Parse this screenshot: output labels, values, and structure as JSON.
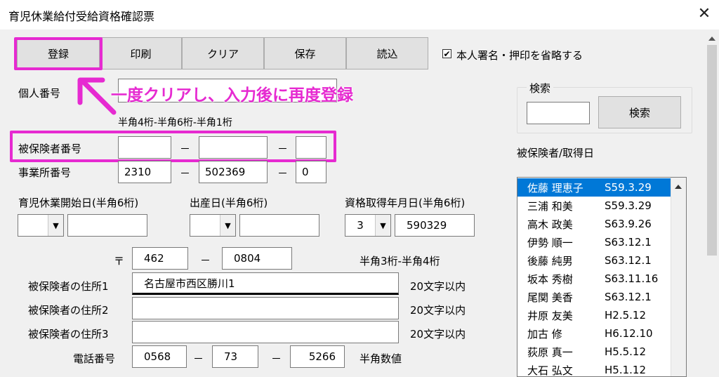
{
  "window": {
    "title": "育児休業給付受給資格確認票",
    "close_glyph": "✕"
  },
  "toolbar": {
    "register": "登録",
    "print": "印刷",
    "clear": "クリア",
    "save": "保存",
    "load": "読込",
    "checkbox_checked": true,
    "checkbox_label": "本人署名・押印を省略する"
  },
  "annotation": {
    "text": "一度クリアし、入力後に再度登録",
    "color": "#e62ad1"
  },
  "form": {
    "personal_number_label": "個人番号",
    "format_hint": "半角4桁-半角6桁-半角1桁",
    "insured_number_label": "被保険者番号",
    "insured_number": [
      "",
      "",
      ""
    ],
    "office_number_label": "事業所番号",
    "office_number": [
      "2310",
      "502369",
      "0"
    ],
    "dash": "－",
    "childcare_start_label": "育児休業開始日(半角6桁)",
    "birth_date_label": "出産日(半角6桁)",
    "qualification_date_label": "資格取得年月日(半角6桁)",
    "qualification_era": "3",
    "qualification_date": "590329",
    "postal_mark": "〒",
    "postal": [
      "462",
      "0804"
    ],
    "postal_hint": "半角3桁-半角4桁",
    "address1_label": "被保険者の住所1",
    "address1": "名古屋市西区勝川1",
    "address2_label": "被保険者の住所2",
    "address2": "",
    "address3_label": "被保険者の住所3",
    "address3": "",
    "address_hint": "20文字以内",
    "phone_label": "電話番号",
    "phone": [
      "0568",
      "73",
      "5266"
    ],
    "phone_hint": "半角数値"
  },
  "search": {
    "group_label": "検索",
    "input_value": "",
    "button": "検索",
    "list_label": "被保険者/取得日",
    "items": [
      {
        "name": "佐藤 理恵子",
        "date": "S59.3.29",
        "selected": true
      },
      {
        "name": "三浦 和美",
        "date": "S59.3.29"
      },
      {
        "name": "高木 政美",
        "date": "S63.9.26"
      },
      {
        "name": "伊勢 順一",
        "date": "S63.12.1"
      },
      {
        "name": "後藤 純男",
        "date": "S63.12.1"
      },
      {
        "name": "坂本 秀樹",
        "date": "S63.11.16"
      },
      {
        "name": "尾関 美香",
        "date": "S63.12.1"
      },
      {
        "name": "井原 友美",
        "date": "H2.5.12"
      },
      {
        "name": "加古 修",
        "date": "H6.12.10"
      },
      {
        "name": "荻原 真一",
        "date": "H5.5.12"
      },
      {
        "name": "大石 弘文",
        "date": "H5.1.12"
      }
    ]
  }
}
